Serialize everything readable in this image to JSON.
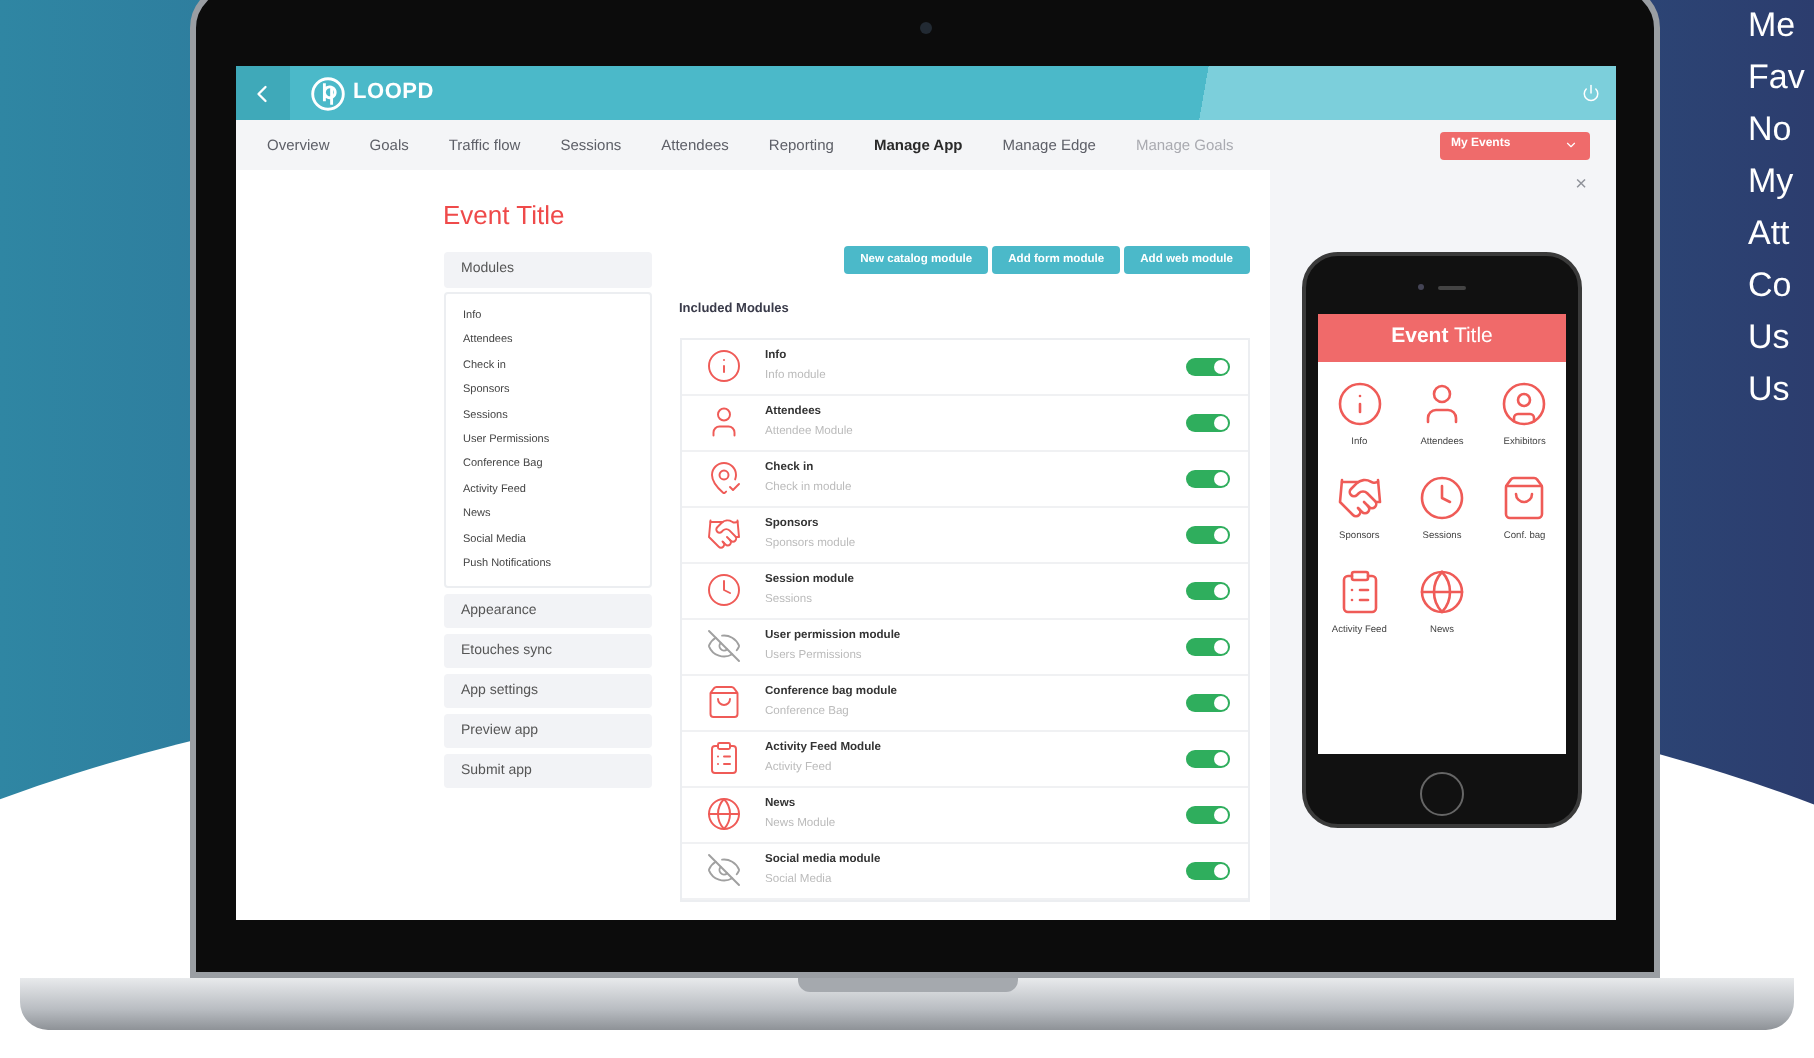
{
  "app": {
    "logo": "LOOPD"
  },
  "nav": [
    {
      "label": "Overview",
      "selected": false,
      "disabled": false
    },
    {
      "label": "Goals",
      "selected": false,
      "disabled": false
    },
    {
      "label": "Traffic flow",
      "selected": false,
      "disabled": false
    },
    {
      "label": "Sessions",
      "selected": false,
      "disabled": false
    },
    {
      "label": "Attendees",
      "selected": false,
      "disabled": false
    },
    {
      "label": "Reporting",
      "selected": false,
      "disabled": false
    },
    {
      "label": "Manage App",
      "selected": true,
      "disabled": false
    },
    {
      "label": "Manage Edge",
      "selected": false,
      "disabled": false
    },
    {
      "label": "Manage Goals",
      "selected": false,
      "disabled": true
    }
  ],
  "events_dropdown": {
    "label": "My Events"
  },
  "event_title": "Event Title",
  "sidebar": {
    "modules": {
      "label": "Modules",
      "items": [
        "Info",
        "Attendees",
        "Check in",
        "Sponsors",
        "Sessions",
        "User Permissions",
        "Conference Bag",
        "Activity Feed",
        "News",
        "Social Media",
        "Push Notifications"
      ]
    },
    "sections": [
      "Appearance",
      "Etouches sync",
      "App settings",
      "Preview app",
      "Submit app"
    ]
  },
  "actions": [
    "New catalog module",
    "Add form module",
    "Add web module"
  ],
  "included_heading": "Included Modules",
  "modules": [
    {
      "title": "Info",
      "subtitle": "Info module",
      "kind": "info",
      "on": true
    },
    {
      "title": "Attendees",
      "subtitle": "Attendee Module",
      "kind": "user",
      "on": true
    },
    {
      "title": "Check in",
      "subtitle": "Check in module",
      "kind": "pin",
      "on": true
    },
    {
      "title": "Sponsors",
      "subtitle": "Sponsors module",
      "kind": "handshake",
      "on": true
    },
    {
      "title": "Session module",
      "subtitle": "Sessions",
      "kind": "clock",
      "on": true
    },
    {
      "title": "User permission module",
      "subtitle": "Users Permissions",
      "kind": "hidden",
      "on": true
    },
    {
      "title": "Conference bag module",
      "subtitle": "Conference Bag",
      "kind": "bag",
      "on": true
    },
    {
      "title": "Activity Feed Module",
      "subtitle": "Activity Feed",
      "kind": "feed",
      "on": true
    },
    {
      "title": "News",
      "subtitle": "News Module",
      "kind": "globe",
      "on": true
    },
    {
      "title": "Social media module",
      "subtitle": "Social Media",
      "kind": "hidden",
      "on": true
    }
  ],
  "preview": {
    "title_bold": "Event",
    "title_rest": "Title",
    "close": "×",
    "tiles": [
      {
        "label": "Info",
        "kind": "info"
      },
      {
        "label": "Attendees",
        "kind": "user"
      },
      {
        "label": "Exhibitors",
        "kind": "usercircle"
      },
      {
        "label": "Sponsors",
        "kind": "handshake"
      },
      {
        "label": "Sessions",
        "kind": "clock"
      },
      {
        "label": "Conf. bag",
        "kind": "bag"
      },
      {
        "label": "Activity Feed",
        "kind": "feed"
      },
      {
        "label": "News",
        "kind": "globe"
      }
    ]
  },
  "side_words": [
    "Me",
    "Fav",
    "No",
    "My",
    "Att",
    "Co",
    "Us",
    "Us"
  ]
}
